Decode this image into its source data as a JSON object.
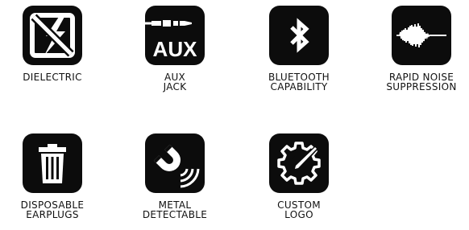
{
  "features": [
    {
      "icon": "no-lightning-icon",
      "label": "DIELECTRIC"
    },
    {
      "icon": "aux-jack-icon",
      "text": "AUX",
      "label": "AUX\nJACK"
    },
    {
      "icon": "bluetooth-icon",
      "label": "BLUETOOTH\nCAPABILITY"
    },
    {
      "icon": "waveform-icon",
      "label": "RAPID NOISE\nSUPPRESSION"
    },
    {
      "icon": "trash-can-icon",
      "label": "DISPOSABLE\nEARPLUGS"
    },
    {
      "icon": "magnet-icon",
      "label": "METAL\nDETECTABLE"
    },
    {
      "icon": "gear-pencil-icon",
      "label": "CUSTOM\nLOGO"
    }
  ]
}
